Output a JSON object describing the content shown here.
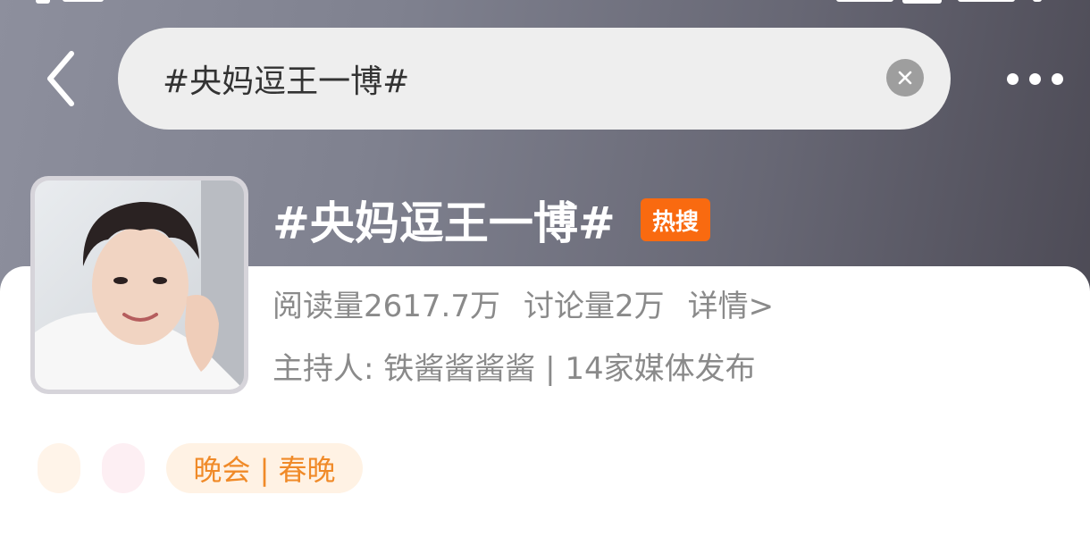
{
  "colors": {
    "header_start": "#8d8f9d",
    "header_end": "#4d4b56",
    "hot_badge": "#f96a10",
    "tag_text": "#f08a28",
    "meta_text": "#8a8a8a"
  },
  "nav": {
    "back_icon": "chevron-left-icon",
    "more_icon": "more-horizontal-icon"
  },
  "search": {
    "value": "#央妈逗王一博#",
    "clear_icon": "close-circle-icon"
  },
  "topic": {
    "title": "#央妈逗王一博#",
    "hot_badge": "热搜",
    "reads": "阅读量2617.7万",
    "discussions": "讨论量2万",
    "details_link": "详情>",
    "host_line": "主持人: 铁酱酱酱酱 | 14家媒体发布"
  },
  "tags": {
    "main_tag": "晚会 | 春晚"
  }
}
